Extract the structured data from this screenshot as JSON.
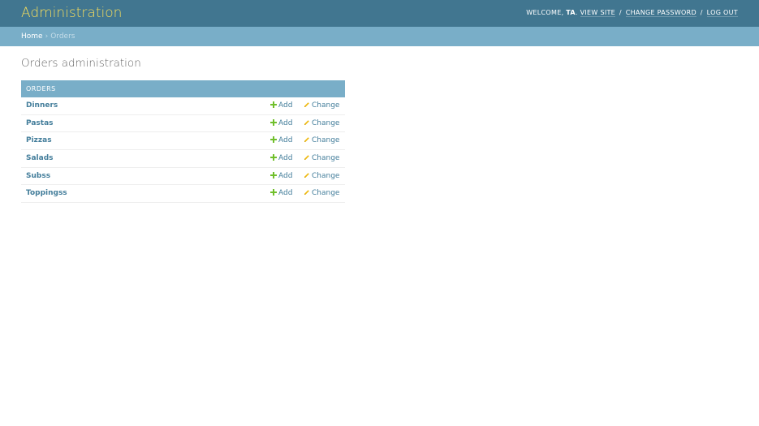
{
  "header": {
    "branding": "Administration",
    "welcome": "WELCOME,",
    "username": "TA",
    "username_suffix": ".",
    "view_site": "VIEW SITE",
    "change_password": "CHANGE PASSWORD",
    "log_out": "LOG OUT",
    "separator": "/"
  },
  "breadcrumbs": {
    "home": "Home",
    "separator": "›",
    "current": "Orders"
  },
  "page_title": "Orders administration",
  "module": {
    "caption": "ORDERS",
    "add_label": "Add",
    "change_label": "Change",
    "models": [
      {
        "name": "Dinners"
      },
      {
        "name": "Pastas"
      },
      {
        "name": "Pizzas"
      },
      {
        "name": "Salads"
      },
      {
        "name": "Subss"
      },
      {
        "name": "Toppingss"
      }
    ]
  },
  "colors": {
    "header_bg": "#417690",
    "branding": "#f5dd5d",
    "breadcrumbs_bg": "#79aec8",
    "caption_bg": "#79aec8",
    "link": "#447e9b",
    "add_icon": "#70bf2b",
    "change_icon": "#efb80b"
  },
  "icons": {
    "add": "plus-icon",
    "change": "pencil-icon"
  }
}
